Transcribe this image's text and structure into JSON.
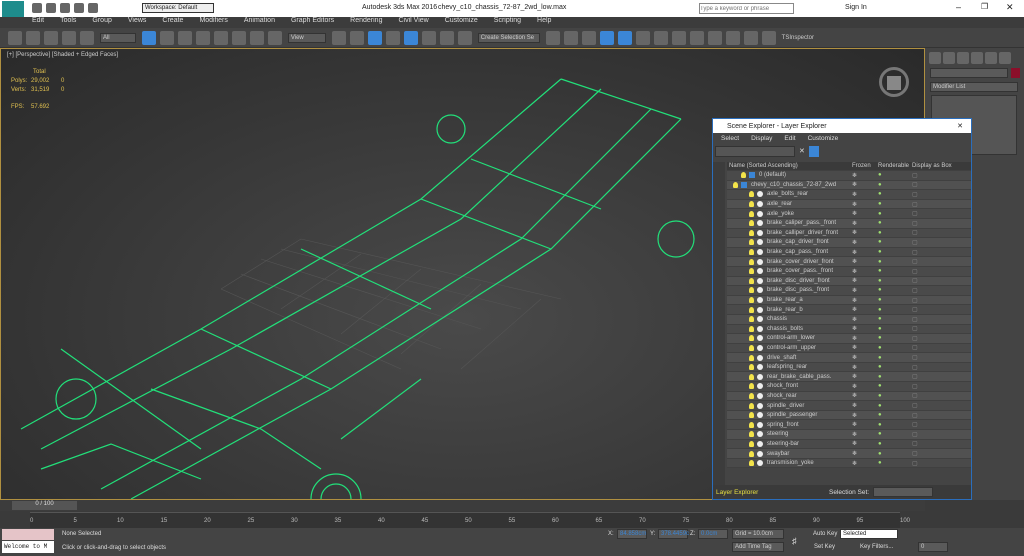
{
  "titlebar": {
    "app": "Autodesk 3ds Max 2016",
    "file": "chevy_c10_chassis_72-87_2wd_low.max",
    "workspace": "Workspace: Default",
    "search_placeholder": "Type a keyword or phrase",
    "sign_in": "Sign In",
    "logo": "MAX"
  },
  "menu": [
    "Edit",
    "Tools",
    "Group",
    "Views",
    "Create",
    "Modifiers",
    "Animation",
    "Graph Editors",
    "Rendering",
    "Civil View",
    "Customize",
    "Scripting",
    "Help"
  ],
  "toolbar": {
    "filter": "All",
    "ref_coord": "View",
    "selection_set": "Create Selection Se",
    "tsinspector": "TSInspector"
  },
  "viewport": {
    "label": "[+] [Perspective] [Shaded + Edged Faces]",
    "stats": {
      "total": "Total",
      "polys_label": "Polys:",
      "polys": "29,002",
      "polys_sel": "0",
      "verts_label": "Verts:",
      "verts": "31,519",
      "verts_sel": "0",
      "fps_label": "FPS:",
      "fps": "57.692"
    }
  },
  "command_panel": {
    "modifier_list": "Modifier List",
    "object_color": "#8b0f2a"
  },
  "scene_explorer": {
    "title": "Scene Explorer - Layer Explorer",
    "menu": [
      "Select",
      "Display",
      "Edit",
      "Customize"
    ],
    "columns": [
      "Name (Sorted Ascending)",
      "Frozen",
      "Renderable",
      "Display as Box"
    ],
    "layers": [
      "0 (default)",
      "chevy_c10_chassis_72-87_2wd"
    ],
    "objects": [
      "axle_bolts_rear",
      "axle_rear",
      "axle_yoke",
      "brake_caliper_pass._front",
      "brake_calliper_driver_front",
      "brake_cap_driver_front",
      "brake_cap_pass._front",
      "brake_cover_driver_front",
      "brake_cover_pass._front",
      "brake_disc_driver_front",
      "brake_disc_pass._front",
      "brake_rear_a",
      "brake_rear_b",
      "chassis",
      "chassis_bolts",
      "control-arm_lower",
      "control-arm_upper",
      "drive_shaft",
      "leafspring_rear",
      "rear_brake_cable_pass.",
      "shock_front",
      "shock_rear",
      "spindle_driver",
      "spindle_passenger",
      "spring_front",
      "steering",
      "steering-bar",
      "swaybar",
      "transmision_yoke"
    ],
    "footer": {
      "mode": "Layer Explorer",
      "selection_set": "Selection Set:"
    }
  },
  "timeline": {
    "frame": "0 / 100",
    "ticks": [
      "0",
      "5",
      "10",
      "15",
      "20",
      "25",
      "30",
      "35",
      "40",
      "45",
      "50",
      "55",
      "60",
      "65",
      "70",
      "75",
      "80",
      "85",
      "90",
      "95",
      "100"
    ]
  },
  "status": {
    "maxscript": "Welcome to M",
    "selected": "None Selected",
    "prompt": "Click or click-and-drag to select objects",
    "x": "84.858cm",
    "y": "378.4459c",
    "z": "0.0cm",
    "grid": "Grid = 10.0cm",
    "add_time_tag": "Add Time Tag",
    "auto_key": "Auto Key",
    "set_key": "Set Key",
    "key_mode": "Selected",
    "key_filters": "Key Filters...",
    "frame_field": "0"
  }
}
